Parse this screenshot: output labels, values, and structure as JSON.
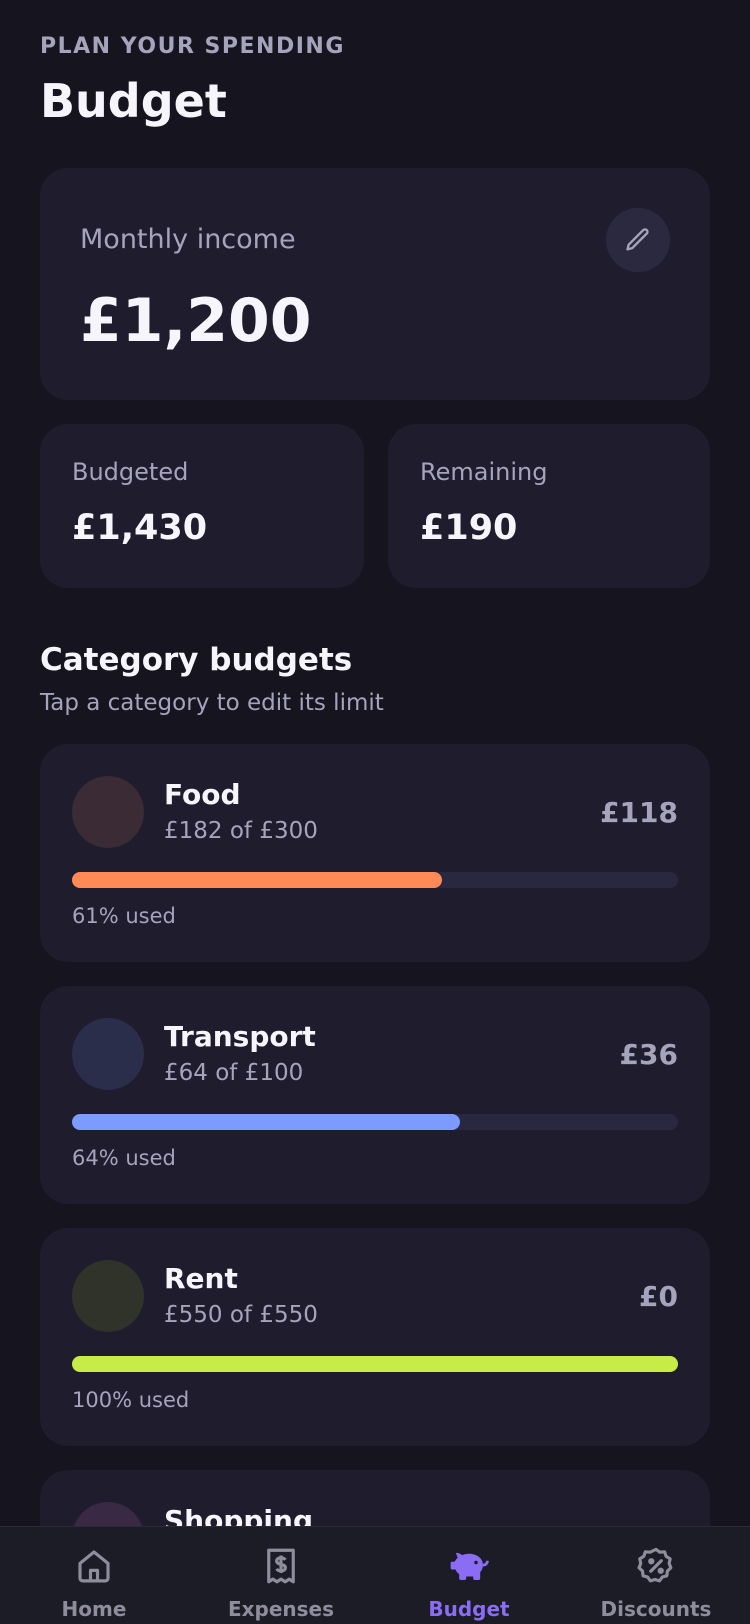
{
  "header": {
    "eyebrow": "PLAN YOUR SPENDING",
    "title": "Budget"
  },
  "income": {
    "label": "Monthly income",
    "value": "£1,200",
    "edit_icon": "pencil-icon"
  },
  "stats": {
    "budgeted": {
      "label": "Budgeted",
      "value": "£1,430"
    },
    "remaining": {
      "label": "Remaining",
      "value": "£190"
    }
  },
  "categories_section": {
    "title": "Category budgets",
    "subtitle": "Tap a category to edit its limit",
    "items": [
      {
        "name": "Food",
        "spent": "£182 of £300",
        "remaining": "£118",
        "used": "61% used",
        "percent": 61,
        "color": "#ff8a56",
        "icon_bg": "#3a2b35"
      },
      {
        "name": "Transport",
        "spent": "£64 of £100",
        "remaining": "£36",
        "used": "64% used",
        "percent": 64,
        "color": "#7c9bff",
        "icon_bg": "#2a2e4a"
      },
      {
        "name": "Rent",
        "spent": "£550 of £550",
        "remaining": "£0",
        "used": "100% used",
        "percent": 100,
        "color": "#c6ec45",
        "icon_bg": "#303329"
      },
      {
        "name": "Shopping",
        "spent": "",
        "remaining": "",
        "used": "",
        "percent": 0,
        "color": "#c86bd6",
        "icon_bg": "#3a2945"
      }
    ]
  },
  "tabbar": {
    "items": [
      {
        "label": "Home",
        "icon": "home-icon",
        "active": false
      },
      {
        "label": "Expenses",
        "icon": "receipt-icon",
        "active": false
      },
      {
        "label": "Budget",
        "icon": "piggy-bank-icon",
        "active": true
      },
      {
        "label": "Discounts",
        "icon": "discount-badge-icon",
        "active": false
      }
    ],
    "active_color": "#8b6cf5",
    "inactive_color": "#8f8d9d"
  }
}
